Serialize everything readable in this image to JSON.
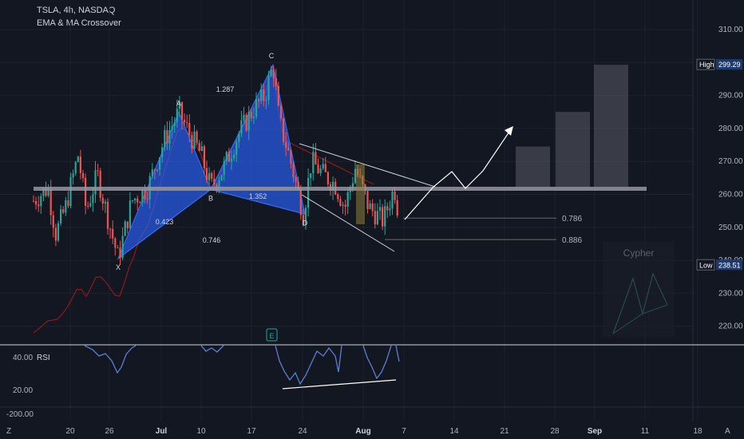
{
  "header": {
    "symbol_line": "TSLA, 4h, NASDAQ",
    "indicator_name": "EMA & MA Crossover"
  },
  "colors": {
    "background": "#131722",
    "bull": "#26a69a",
    "bear": "#ef5350",
    "pattern_fill": "#2962ff",
    "grid": "#1e222d",
    "rsi_line": "#5b7fd1"
  },
  "chart_data": {
    "type": "line",
    "price_axis": {
      "ylim": [
        213,
        315
      ],
      "ticks": [
        "310.00",
        "300.00",
        "290.00",
        "280.00",
        "270.00",
        "260.00",
        "250.00",
        "240.00",
        "230.00",
        "220.00"
      ]
    },
    "high": {
      "label": "High",
      "value": "299.29"
    },
    "low": {
      "label": "Low",
      "value": "238.51"
    },
    "x_ticks": [
      "20",
      "26",
      "Jul",
      "10",
      "17",
      "24",
      "Aug",
      "7",
      "14",
      "21",
      "28",
      "Sep",
      "11",
      "18"
    ],
    "harmonic_points": [
      {
        "name": "X",
        "value": 240.5
      },
      {
        "name": "A",
        "value": 285
      },
      {
        "name": "B",
        "value": 261.5
      },
      {
        "name": "C",
        "value": 299.29
      },
      {
        "name": "D",
        "value": 254
      }
    ],
    "harmonic_ratios": [
      "1.287",
      "0.423",
      "1.352",
      "0.746"
    ],
    "fib_levels": [
      {
        "label": "0.786",
        "value": 252.8
      },
      {
        "label": "0.886",
        "value": 246.3
      }
    ],
    "resistance_level": 261.7,
    "projected_bars": [
      {
        "name": "bar1",
        "value": 274.5
      },
      {
        "name": "bar2",
        "value": 285
      },
      {
        "name": "bar3",
        "value": 299.3
      }
    ],
    "rsi": {
      "label": "RSI",
      "ticks": [
        "40.00",
        "20.00",
        "-200.00"
      ]
    },
    "inset_label": "Cypher",
    "event_marker": "E"
  },
  "bottom_bar": {
    "left_icon": "Z",
    "right_icon": "A"
  }
}
